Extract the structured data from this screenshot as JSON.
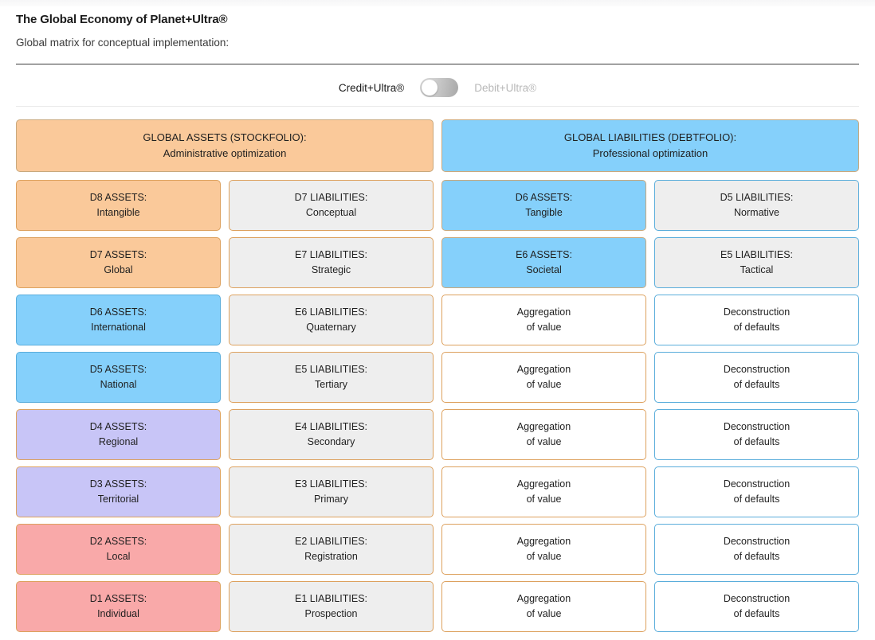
{
  "header": {
    "title": "The Global Economy of Planet+Ultra®",
    "subtitle": "Global matrix for conceptual implementation:"
  },
  "toggle": {
    "left_label": "Credit+Ultra®",
    "right_label": "Debit+Ultra®",
    "state": "left",
    "knob_color": "#ffffff"
  },
  "colors": {
    "orange_fill": "#fac99a",
    "blue_fill": "#85d0fb",
    "purple_fill": "#c8c5f7",
    "pink_fill": "#f9a9a9",
    "gray_fill": "#eeeeee",
    "white_fill": "#ffffff",
    "orange_border": "#dda15e",
    "tan_border": "#c9a87c",
    "blue_border": "#5aaddb",
    "light_border": "#dcdcdc"
  },
  "group_headers": [
    {
      "line1": "GLOBAL ASSETS (STOCKFOLIO):",
      "line2": "Administrative optimization"
    },
    {
      "line1": "GLOBAL LIABILITIES (DEBTFOLIO):",
      "line2": "Professional optimization"
    }
  ],
  "rows": [
    [
      {
        "line1": "D8 ASSETS:",
        "line2": "Intangible"
      },
      {
        "line1": "D7 LIABILITIES:",
        "line2": "Conceptual"
      },
      {
        "line1": "D6 ASSETS:",
        "line2": "Tangible"
      },
      {
        "line1": "D5 LIABILITIES:",
        "line2": "Normative"
      }
    ],
    [
      {
        "line1": "D7 ASSETS:",
        "line2": "Global"
      },
      {
        "line1": "E7 LIABILITIES:",
        "line2": "Strategic"
      },
      {
        "line1": "E6 ASSETS:",
        "line2": "Societal"
      },
      {
        "line1": "E5 LIABILITIES:",
        "line2": "Tactical"
      }
    ],
    [
      {
        "line1": "D6 ASSETS:",
        "line2": "International"
      },
      {
        "line1": "E6 LIABILITIES:",
        "line2": "Quaternary"
      },
      {
        "line1": "Aggregation",
        "line2": "of value"
      },
      {
        "line1": "Deconstruction",
        "line2": "of defaults"
      }
    ],
    [
      {
        "line1": "D5 ASSETS:",
        "line2": "National"
      },
      {
        "line1": "E5 LIABILITIES:",
        "line2": "Tertiary"
      },
      {
        "line1": "Aggregation",
        "line2": "of value"
      },
      {
        "line1": "Deconstruction",
        "line2": "of defaults"
      }
    ],
    [
      {
        "line1": "D4 ASSETS:",
        "line2": "Regional"
      },
      {
        "line1": "E4 LIABILITIES:",
        "line2": "Secondary"
      },
      {
        "line1": "Aggregation",
        "line2": "of value"
      },
      {
        "line1": "Deconstruction",
        "line2": "of defaults"
      }
    ],
    [
      {
        "line1": "D3 ASSETS:",
        "line2": "Territorial"
      },
      {
        "line1": "E3 LIABILITIES:",
        "line2": "Primary"
      },
      {
        "line1": "Aggregation",
        "line2": "of value"
      },
      {
        "line1": "Deconstruction",
        "line2": "of defaults"
      }
    ],
    [
      {
        "line1": "D2 ASSETS:",
        "line2": "Local"
      },
      {
        "line1": "E2 LIABILITIES:",
        "line2": "Registration"
      },
      {
        "line1": "Aggregation",
        "line2": "of value"
      },
      {
        "line1": "Deconstruction",
        "line2": "of defaults"
      }
    ],
    [
      {
        "line1": "D1 ASSETS:",
        "line2": "Individual"
      },
      {
        "line1": "E1 LIABILITIES:",
        "line2": "Prospection"
      },
      {
        "line1": "Aggregation",
        "line2": "of value"
      },
      {
        "line1": "Deconstruction",
        "line2": "of defaults"
      }
    ]
  ]
}
